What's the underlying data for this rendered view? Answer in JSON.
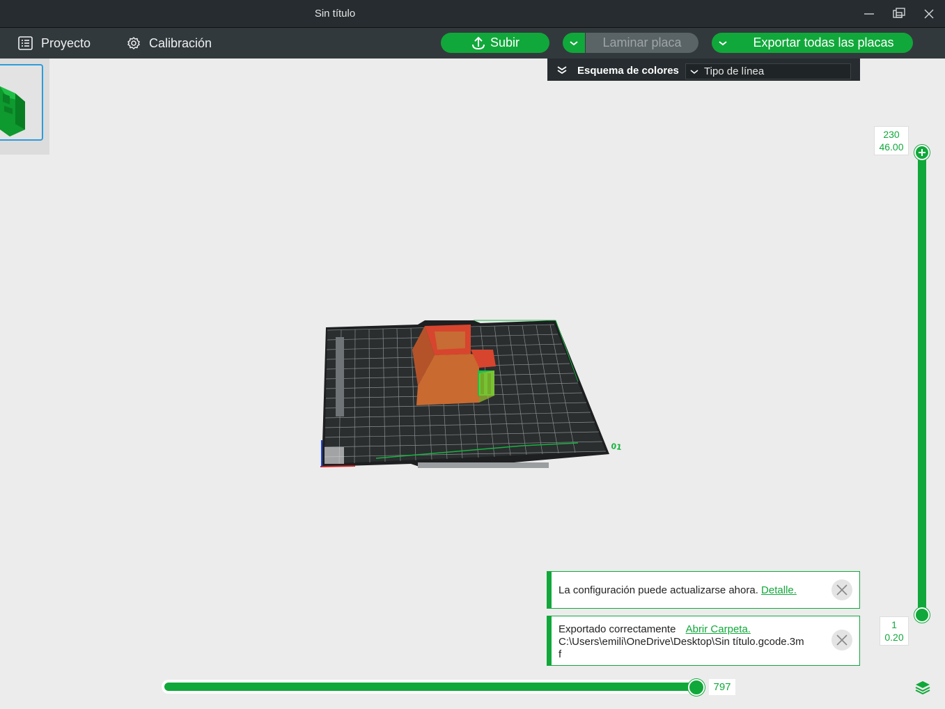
{
  "window": {
    "title": "Sin título"
  },
  "toolbar": {
    "project_label": "Proyecto",
    "calibration_label": "Calibración",
    "upload_label": "Subir",
    "slice_label": "Laminar placa",
    "export_label": "Exportar todas las placas"
  },
  "color_scheme": {
    "label": "Esquema de colores",
    "selected": "Tipo de línea"
  },
  "layer_slider": {
    "top_layer": "230",
    "top_height": "46.00",
    "bottom_layer": "1",
    "bottom_height": "0.20"
  },
  "move_slider": {
    "value": "797",
    "fraction": 0.98
  },
  "plate": {
    "number_label": "01"
  },
  "notifications": [
    {
      "text": "La configuración puede actualizarse ahora.",
      "link": "Detalle."
    },
    {
      "text": "Exportado correctamente",
      "link": "Abrir Carpeta.",
      "path": "C:\\Users\\emili\\OneDrive\\Desktop\\Sin título.gcode.3m",
      "path_tail": "f"
    }
  ],
  "colors": {
    "accent": "#10a83a",
    "titlebar": "#262c2f",
    "toolbar": "#32393c",
    "canvas": "#ececec"
  }
}
